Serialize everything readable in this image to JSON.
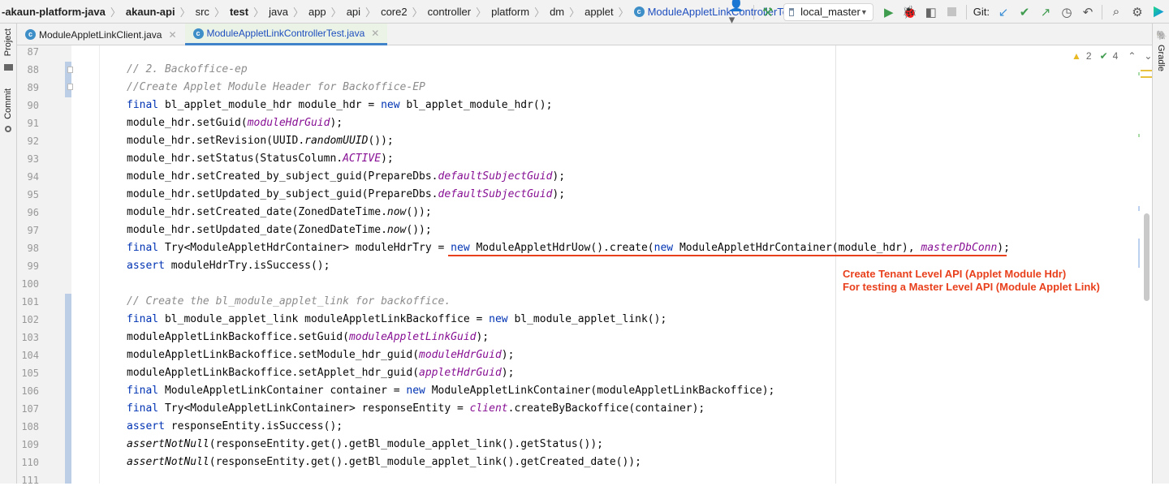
{
  "breadcrumb": [
    {
      "label": "-akaun-platform-java",
      "bold": true
    },
    {
      "label": "akaun-api",
      "bold": true
    },
    {
      "label": "src"
    },
    {
      "label": "test",
      "bold": true
    },
    {
      "label": "java"
    },
    {
      "label": "app"
    },
    {
      "label": "api"
    },
    {
      "label": "core2"
    },
    {
      "label": "controller"
    },
    {
      "label": "platform"
    },
    {
      "label": "dm"
    },
    {
      "label": "applet"
    },
    {
      "label": "ModuleAppletLinkControllerTest",
      "current": true
    }
  ],
  "toolbar": {
    "run_config": "local_master",
    "git_label": "Git:"
  },
  "sidebar_left": {
    "project": "Project",
    "commit": "Commit"
  },
  "sidebar_right": {
    "gradle": "Gradle"
  },
  "tabs": [
    {
      "label": "ModuleAppletLinkClient.java",
      "active": false
    },
    {
      "label": "ModuleAppletLinkControllerTest.java",
      "active": true
    }
  ],
  "inspections": {
    "warnings": "2",
    "checks": "4"
  },
  "annotation": {
    "line1": "Create Tenant Level API (Applet Module Hdr)",
    "line2": "For testing a Master Level API (Module Applet Link)"
  },
  "code": [
    {
      "n": "87",
      "t": []
    },
    {
      "n": "88",
      "t": [
        [
          "// 2. Backoffice-ep",
          "c"
        ]
      ]
    },
    {
      "n": "89",
      "t": [
        [
          "//Create Applet Module Header for Backoffice-EP",
          "c"
        ]
      ]
    },
    {
      "n": "90",
      "t": [
        [
          "final",
          "k"
        ],
        [
          " bl_applet_module_hdr module_hdr = ",
          ""
        ],
        [
          "new",
          "k"
        ],
        [
          " bl_applet_module_hdr();",
          ""
        ]
      ]
    },
    {
      "n": "91",
      "t": [
        [
          "module_hdr.setGuid(",
          ""
        ],
        [
          "moduleHdrGuid",
          "f"
        ],
        [
          ");",
          ""
        ]
      ]
    },
    {
      "n": "92",
      "t": [
        [
          "module_hdr.setRevision(UUID.",
          ""
        ],
        [
          "randomUUID",
          "s"
        ],
        [
          "());",
          ""
        ]
      ]
    },
    {
      "n": "93",
      "t": [
        [
          "module_hdr.setStatus(StatusColumn.",
          ""
        ],
        [
          "ACTIVE",
          "f"
        ],
        [
          ");",
          ""
        ]
      ]
    },
    {
      "n": "94",
      "t": [
        [
          "module_hdr.setCreated_by_subject_guid(PrepareDbs.",
          ""
        ],
        [
          "defaultSubjectGuid",
          "f"
        ],
        [
          ");",
          ""
        ]
      ]
    },
    {
      "n": "95",
      "t": [
        [
          "module_hdr.setUpdated_by_subject_guid(PrepareDbs.",
          ""
        ],
        [
          "defaultSubjectGuid",
          "f"
        ],
        [
          ");",
          ""
        ]
      ]
    },
    {
      "n": "96",
      "t": [
        [
          "module_hdr.setCreated_date(ZonedDateTime.",
          ""
        ],
        [
          "now",
          "s"
        ],
        [
          "());",
          ""
        ]
      ]
    },
    {
      "n": "97",
      "t": [
        [
          "module_hdr.setUpdated_date(ZonedDateTime.",
          ""
        ],
        [
          "now",
          "s"
        ],
        [
          "());",
          ""
        ]
      ]
    },
    {
      "n": "98",
      "t": [
        [
          "final",
          "k"
        ],
        [
          " Try<ModuleAppletHdrContainer> moduleHdrTry = ",
          ""
        ],
        [
          "new",
          "k"
        ],
        [
          " ModuleAppletHdrUow().create(",
          ""
        ],
        [
          "new",
          "k"
        ],
        [
          " ModuleAppletHdrContainer(module_hdr), ",
          ""
        ],
        [
          "masterDbConn",
          "f"
        ],
        [
          ");",
          ""
        ]
      ]
    },
    {
      "n": "99",
      "t": [
        [
          "assert",
          "k"
        ],
        [
          " moduleHdrTry.isSuccess();",
          ""
        ]
      ]
    },
    {
      "n": "100",
      "t": []
    },
    {
      "n": "101",
      "t": [
        [
          "// Create the bl_module_applet_link for backoffice.",
          "c"
        ]
      ]
    },
    {
      "n": "102",
      "t": [
        [
          "final",
          "k"
        ],
        [
          " bl_module_applet_link moduleAppletLinkBackoffice = ",
          ""
        ],
        [
          "new",
          "k"
        ],
        [
          " bl_module_applet_link();",
          ""
        ]
      ]
    },
    {
      "n": "103",
      "t": [
        [
          "moduleAppletLinkBackoffice.setGuid(",
          ""
        ],
        [
          "moduleAppletLinkGuid",
          "f"
        ],
        [
          ");",
          ""
        ]
      ]
    },
    {
      "n": "104",
      "t": [
        [
          "moduleAppletLinkBackoffice.setModule_hdr_guid(",
          ""
        ],
        [
          "moduleHdrGuid",
          "f"
        ],
        [
          ");",
          ""
        ]
      ]
    },
    {
      "n": "105",
      "t": [
        [
          "moduleAppletLinkBackoffice.setApplet_hdr_guid(",
          ""
        ],
        [
          "appletHdrGuid",
          "f"
        ],
        [
          ");",
          ""
        ]
      ]
    },
    {
      "n": "106",
      "t": [
        [
          "final",
          "k"
        ],
        [
          " ModuleAppletLinkContainer container = ",
          ""
        ],
        [
          "new",
          "k"
        ],
        [
          " ModuleAppletLinkContainer(moduleAppletLinkBackoffice);",
          ""
        ]
      ]
    },
    {
      "n": "107",
      "t": [
        [
          "final",
          "k"
        ],
        [
          " Try<ModuleAppletLinkContainer> responseEntity = ",
          ""
        ],
        [
          "client",
          "f"
        ],
        [
          ".createByBackoffice(container);",
          ""
        ]
      ]
    },
    {
      "n": "108",
      "t": [
        [
          "assert",
          "k"
        ],
        [
          " responseEntity.isSuccess();",
          ""
        ]
      ]
    },
    {
      "n": "109",
      "t": [
        [
          "assertNotNull",
          "s"
        ],
        [
          "(responseEntity.get().getBl_module_applet_link().getStatus());",
          ""
        ]
      ]
    },
    {
      "n": "110",
      "t": [
        [
          "assertNotNull",
          "s"
        ],
        [
          "(responseEntity.get().getBl_module_applet_link().getCreated_date());",
          ""
        ]
      ]
    },
    {
      "n": "111",
      "t": []
    }
  ]
}
